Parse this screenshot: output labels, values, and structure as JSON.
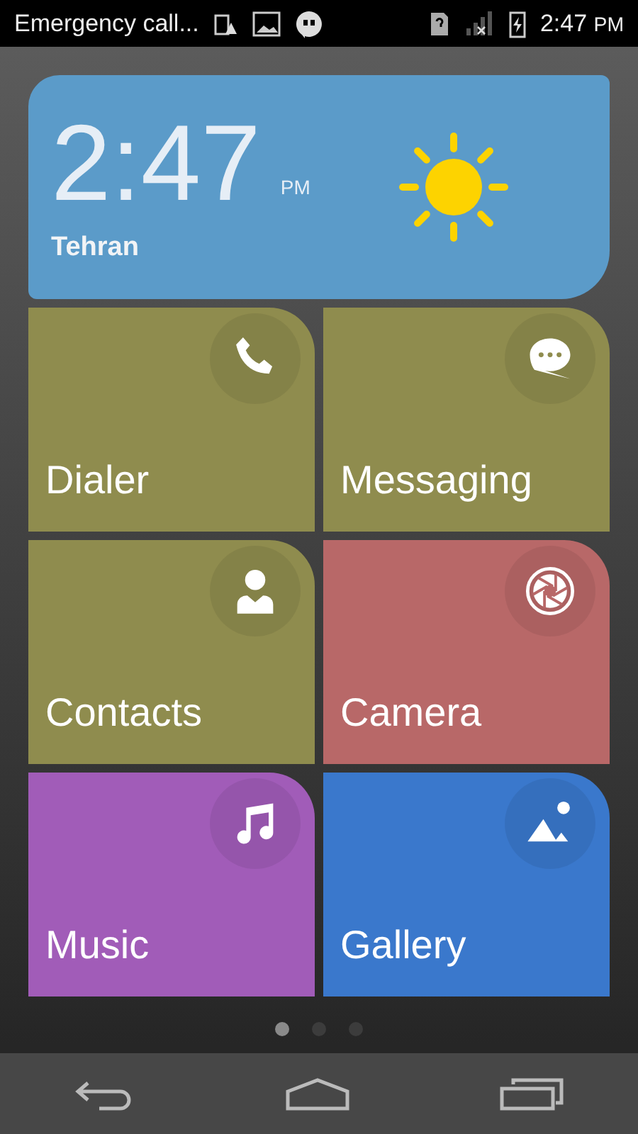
{
  "status_bar": {
    "carrier_text": "Emergency call...",
    "time": "2:47",
    "meridiem": "PM"
  },
  "clock_widget": {
    "time": "2:47",
    "meridiem": "PM",
    "city": "Tehran"
  },
  "tiles": [
    {
      "label": "Dialer",
      "kind": "phone",
      "color": "#8f8c4e"
    },
    {
      "label": "Messaging",
      "kind": "message",
      "color": "#8f8c4e"
    },
    {
      "label": "Contacts",
      "kind": "person",
      "color": "#8f8c4e"
    },
    {
      "label": "Camera",
      "kind": "camera",
      "color": "#b86868"
    },
    {
      "label": "Music",
      "kind": "music",
      "color": "#a15cb8"
    },
    {
      "label": "Gallery",
      "kind": "gallery",
      "color": "#3a78cc"
    }
  ],
  "page_dots": [
    {
      "selected": true
    },
    {
      "selected": false
    },
    {
      "selected": false
    }
  ]
}
